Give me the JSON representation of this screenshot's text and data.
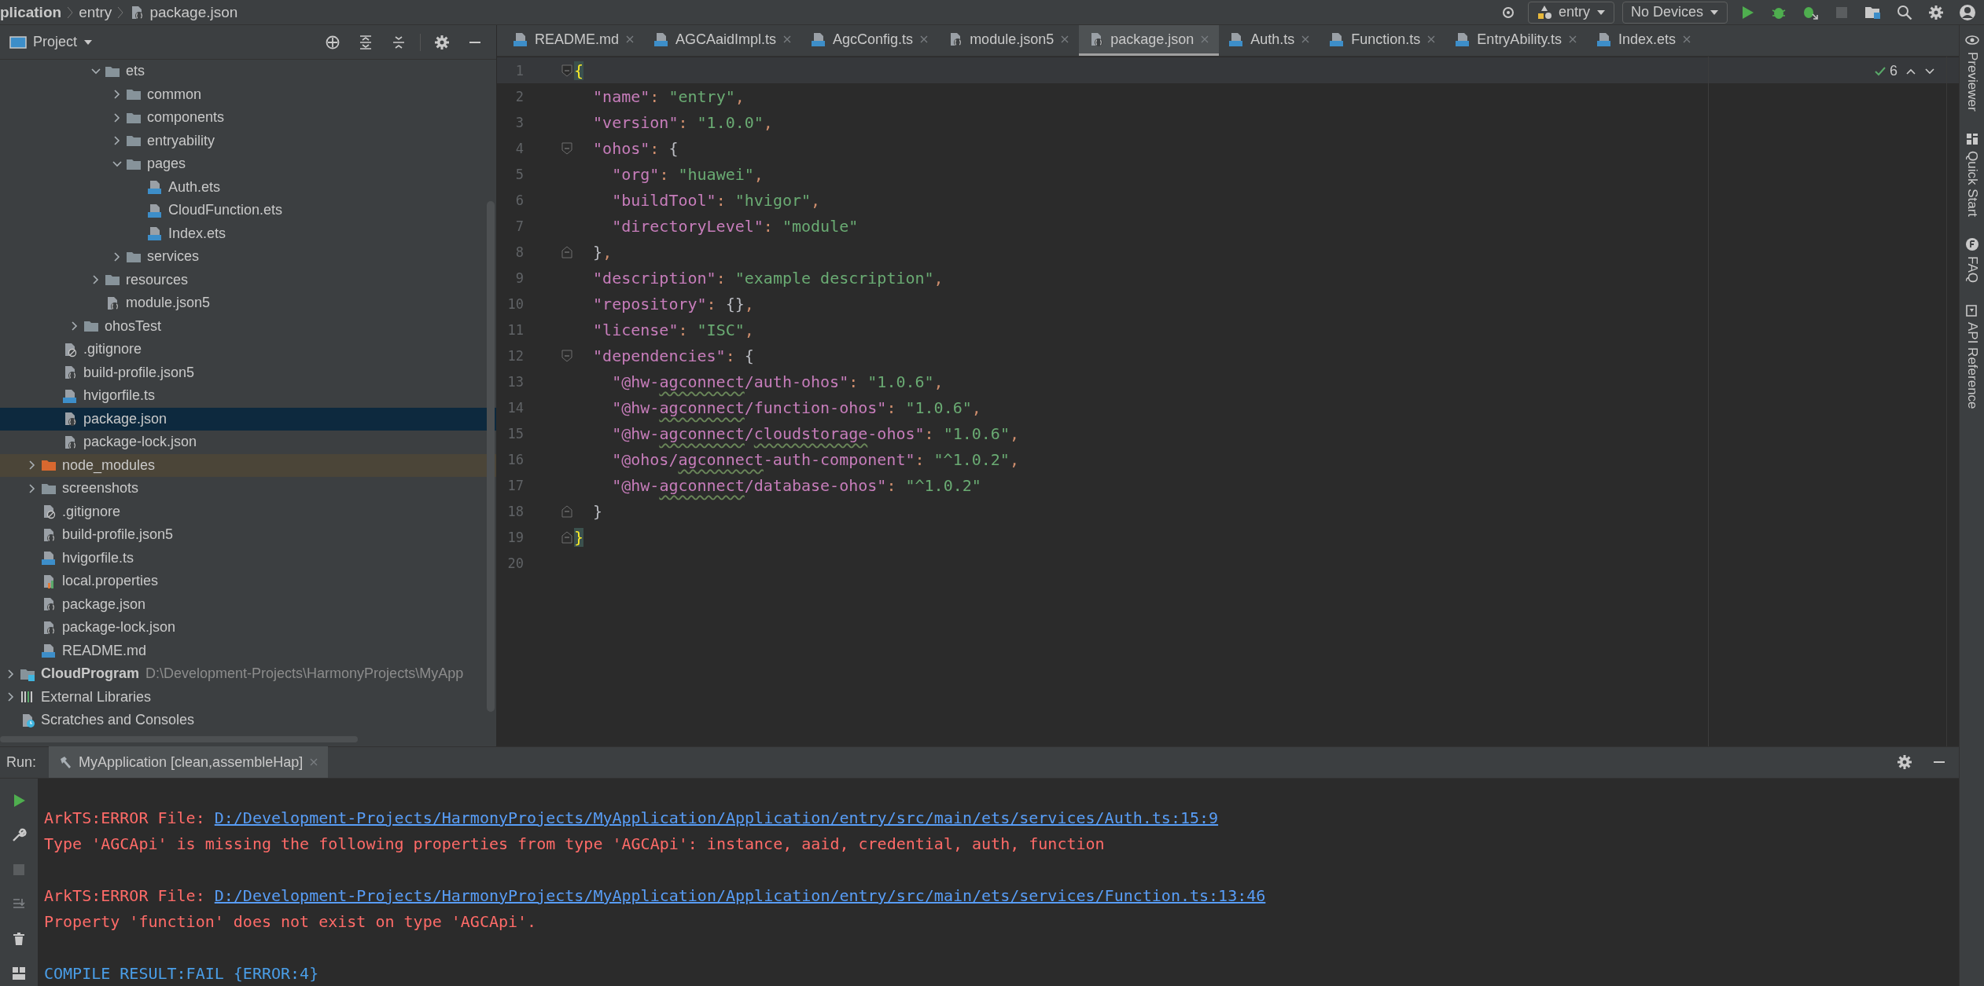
{
  "breadcrumb": [
    {
      "label": "plication",
      "kind": "text"
    },
    {
      "label": "entry",
      "kind": "text"
    },
    {
      "label": "package.json",
      "kind": "json"
    }
  ],
  "toolbar": {
    "config": "entry",
    "device": "No Devices",
    "stop_disabled": true
  },
  "project_panel": {
    "title": "Project",
    "tree": [
      {
        "children": [
          {
            "children": [
              {
                "children": [
                  {
                    "children": [
                      {
                        "label": "ets",
                        "kind": "folder",
                        "expanded": true,
                        "selected": false,
                        "children": [
                          {
                            "label": "common",
                            "kind": "folder",
                            "expanded": false,
                            "selected": false
                          },
                          {
                            "label": "components",
                            "kind": "folder",
                            "expanded": false,
                            "selected": false
                          },
                          {
                            "label": "entryability",
                            "kind": "folder",
                            "expanded": false,
                            "selected": false
                          },
                          {
                            "label": "pages",
                            "kind": "folder",
                            "expanded": true,
                            "selected": false,
                            "children": [
                              {
                                "label": "Auth.ets",
                                "kind": "ets",
                                "selected": false
                              },
                              {
                                "label": "CloudFunction.ets",
                                "kind": "ets",
                                "selected": false
                              },
                              {
                                "label": "Index.ets",
                                "kind": "ets",
                                "selected": false
                              }
                            ]
                          },
                          {
                            "label": "services",
                            "kind": "folder",
                            "expanded": false,
                            "selected": false
                          }
                        ]
                      },
                      {
                        "label": "resources",
                        "kind": "folder",
                        "expanded": false,
                        "selected": false
                      },
                      {
                        "label": "module.json5",
                        "kind": "json",
                        "selected": false
                      }
                    ]
                  },
                  {
                    "label": "ohosTest",
                    "kind": "folder",
                    "expanded": false,
                    "selected": false
                  }
                ]
              },
              {
                "label": ".gitignore",
                "kind": "ignore",
                "selected": false
              },
              {
                "label": "build-profile.json5",
                "kind": "json",
                "selected": false
              },
              {
                "label": "hvigorfile.ts",
                "kind": "ts",
                "selected": false
              },
              {
                "label": "package.json",
                "kind": "json",
                "selected": true
              },
              {
                "label": "package-lock.json",
                "kind": "json",
                "selected": false
              }
            ]
          },
          {
            "label": "node_modules",
            "kind": "excluded-folder",
            "expanded": false,
            "selected": false
          },
          {
            "label": "screenshots",
            "kind": "folder",
            "expanded": false,
            "selected": false
          },
          {
            "label": ".gitignore",
            "kind": "ignore",
            "selected": false
          },
          {
            "label": "build-profile.json5",
            "kind": "json",
            "selected": false
          },
          {
            "label": "hvigorfile.ts",
            "kind": "ts",
            "selected": false
          },
          {
            "label": "local.properties",
            "kind": "properties",
            "selected": false
          },
          {
            "label": "package.json",
            "kind": "json",
            "selected": false
          },
          {
            "label": "package-lock.json",
            "kind": "json",
            "selected": false
          },
          {
            "label": "README.md",
            "kind": "md",
            "selected": false
          }
        ]
      },
      {
        "label": "CloudProgram",
        "kind": "module",
        "path": "D:\\Development-Projects\\HarmonyProjects\\MyApp",
        "expanded": false,
        "selected": false
      },
      {
        "label": "External Libraries",
        "kind": "libraries",
        "expanded": false,
        "selected": false
      },
      {
        "label": "Scratches and Consoles",
        "kind": "scratches",
        "selected": false
      }
    ]
  },
  "tabs": [
    {
      "label": "README.md",
      "kind": "md",
      "selected": false
    },
    {
      "label": "AGCAaidImpl.ts",
      "kind": "ts",
      "selected": false
    },
    {
      "label": "AgcConfig.ts",
      "kind": "ts",
      "selected": false
    },
    {
      "label": "module.json5",
      "kind": "json",
      "selected": false
    },
    {
      "label": "package.json",
      "kind": "json",
      "selected": true
    },
    {
      "label": "Auth.ts",
      "kind": "ts",
      "selected": false
    },
    {
      "label": "Function.ts",
      "kind": "ts",
      "selected": false
    },
    {
      "label": "EntryAbility.ts",
      "kind": "ts",
      "selected": false
    },
    {
      "label": "Index.ets",
      "kind": "ets",
      "selected": false
    }
  ],
  "editor": {
    "inspection_count": "6",
    "lines": [
      {
        "number": "1",
        "kind": "fold-start",
        "current": true,
        "segments": [
          {
            "kind": "brace-match",
            "text": "{"
          }
        ]
      },
      {
        "number": "2",
        "kind": "plain",
        "segments": [
          {
            "kind": "key",
            "text": "  \"name\""
          },
          {
            "kind": "punct",
            "text": ": "
          },
          {
            "kind": "string",
            "text": "\"entry\""
          },
          {
            "kind": "punct",
            "text": ","
          }
        ]
      },
      {
        "number": "3",
        "kind": "plain",
        "segments": [
          {
            "kind": "key",
            "text": "  \"version\""
          },
          {
            "kind": "punct",
            "text": ": "
          },
          {
            "kind": "string",
            "text": "\"1.0.0\""
          },
          {
            "kind": "punct",
            "text": ","
          }
        ]
      },
      {
        "number": "4",
        "kind": "fold-start",
        "segments": [
          {
            "kind": "key",
            "text": "  \"ohos\""
          },
          {
            "kind": "punct",
            "text": ": "
          },
          {
            "kind": "brace",
            "text": "{"
          }
        ]
      },
      {
        "number": "5",
        "kind": "plain",
        "segments": [
          {
            "kind": "key",
            "text": "    \"org\""
          },
          {
            "kind": "punct",
            "text": ": "
          },
          {
            "kind": "string",
            "text": "\"huawei\""
          },
          {
            "kind": "punct",
            "text": ","
          }
        ]
      },
      {
        "number": "6",
        "kind": "plain",
        "segments": [
          {
            "kind": "key",
            "text": "    \"buildTool\""
          },
          {
            "kind": "punct",
            "text": ": "
          },
          {
            "kind": "string",
            "text": "\"hvigor\""
          },
          {
            "kind": "punct",
            "text": ","
          }
        ]
      },
      {
        "number": "7",
        "kind": "plain",
        "segments": [
          {
            "kind": "key",
            "text": "    \"directoryLevel\""
          },
          {
            "kind": "punct",
            "text": ": "
          },
          {
            "kind": "string",
            "text": "\"module\""
          }
        ]
      },
      {
        "number": "8",
        "kind": "fold-end",
        "segments": [
          {
            "kind": "brace",
            "text": "  }"
          },
          {
            "kind": "punct",
            "text": ","
          }
        ]
      },
      {
        "number": "9",
        "kind": "plain",
        "segments": [
          {
            "kind": "key",
            "text": "  \"description\""
          },
          {
            "kind": "punct",
            "text": ": "
          },
          {
            "kind": "string",
            "text": "\"example description\""
          },
          {
            "kind": "punct",
            "text": ","
          }
        ]
      },
      {
        "number": "10",
        "kind": "plain",
        "segments": [
          {
            "kind": "key",
            "text": "  \"repository\""
          },
          {
            "kind": "punct",
            "text": ": "
          },
          {
            "kind": "brace",
            "text": "{}"
          },
          {
            "kind": "punct",
            "text": ","
          }
        ]
      },
      {
        "number": "11",
        "kind": "plain",
        "segments": [
          {
            "kind": "key",
            "text": "  \"license\""
          },
          {
            "kind": "punct",
            "text": ": "
          },
          {
            "kind": "string",
            "text": "\"ISC\""
          },
          {
            "kind": "punct",
            "text": ","
          }
        ]
      },
      {
        "number": "12",
        "kind": "fold-start",
        "segments": [
          {
            "kind": "key",
            "text": "  \"dependencies\""
          },
          {
            "kind": "punct",
            "text": ": "
          },
          {
            "kind": "brace",
            "text": "{"
          }
        ]
      },
      {
        "number": "13",
        "kind": "plain",
        "segments": [
          {
            "kind": "key",
            "text": "    \"@hw-"
          },
          {
            "kind": "key",
            "text": "agconnect",
            "typo": true
          },
          {
            "kind": "key",
            "text": "/auth-ohos\""
          },
          {
            "kind": "punct",
            "text": ": "
          },
          {
            "kind": "string",
            "text": "\"1.0.6\""
          },
          {
            "kind": "punct",
            "text": ","
          }
        ]
      },
      {
        "number": "14",
        "kind": "plain",
        "segments": [
          {
            "kind": "key",
            "text": "    \"@hw-"
          },
          {
            "kind": "key",
            "text": "agconnect",
            "typo": true
          },
          {
            "kind": "key",
            "text": "/function-ohos\""
          },
          {
            "kind": "punct",
            "text": ": "
          },
          {
            "kind": "string",
            "text": "\"1.0.6\""
          },
          {
            "kind": "punct",
            "text": ","
          }
        ]
      },
      {
        "number": "15",
        "kind": "plain",
        "segments": [
          {
            "kind": "key",
            "text": "    \"@hw-"
          },
          {
            "kind": "key",
            "text": "agconnect",
            "typo": true
          },
          {
            "kind": "key",
            "text": "/"
          },
          {
            "kind": "key",
            "text": "cloudstorage",
            "typo": true
          },
          {
            "kind": "key",
            "text": "-ohos\""
          },
          {
            "kind": "punct",
            "text": ": "
          },
          {
            "kind": "string",
            "text": "\"1.0.6\""
          },
          {
            "kind": "punct",
            "text": ","
          }
        ]
      },
      {
        "number": "16",
        "kind": "plain",
        "segments": [
          {
            "kind": "key",
            "text": "    \"@ohos/"
          },
          {
            "kind": "key",
            "text": "agconnect",
            "typo": true
          },
          {
            "kind": "key",
            "text": "-auth-component\""
          },
          {
            "kind": "punct",
            "text": ": "
          },
          {
            "kind": "string",
            "text": "\"^1.0.2\""
          },
          {
            "kind": "punct",
            "text": ","
          }
        ]
      },
      {
        "number": "17",
        "kind": "plain",
        "segments": [
          {
            "kind": "key",
            "text": "    \"@hw-"
          },
          {
            "kind": "key",
            "text": "agconnect",
            "typo": true
          },
          {
            "kind": "key",
            "text": "/database-ohos\""
          },
          {
            "kind": "punct",
            "text": ": "
          },
          {
            "kind": "string",
            "text": "\"^1.0.2\""
          }
        ]
      },
      {
        "number": "18",
        "kind": "fold-end",
        "segments": [
          {
            "kind": "brace",
            "text": "  }"
          }
        ]
      },
      {
        "number": "19",
        "kind": "fold-end",
        "segments": [
          {
            "kind": "brace-match",
            "text": "}"
          }
        ]
      },
      {
        "number": "20",
        "kind": "plain"
      }
    ]
  },
  "side_tools": [
    {
      "label": "Previewer",
      "kind": "eye"
    },
    {
      "label": "Quick Start",
      "kind": "grid"
    },
    {
      "label": "FAQ",
      "kind": "faq"
    },
    {
      "label": "API Reference",
      "kind": "api"
    }
  ],
  "run_panel": {
    "title": "Run:",
    "tab": {
      "label": "MyApplication [clean,assembleHap]",
      "selected": true
    },
    "stop_disabled": true,
    "errors": [
      {
        "prefix": "ArkTS:ERROR File: ",
        "link": "D:/Development-Projects/HarmonyProjects/MyApplication/Application/entry/src/main/ets/services/Auth.ts:15:9",
        "message": "Type 'AGCApi' is missing the following properties from type 'AGCApi': instance, aaid, credential, auth, function"
      },
      {
        "prefix": "ArkTS:ERROR File: ",
        "link": "D:/Development-Projects/HarmonyProjects/MyApplication/Application/entry/src/main/ets/services/Function.ts:13:46",
        "message": "Property 'function' does not exist on type 'AGCApi'."
      }
    ],
    "result": "COMPILE RESULT:FAIL {ERROR:4}"
  }
}
